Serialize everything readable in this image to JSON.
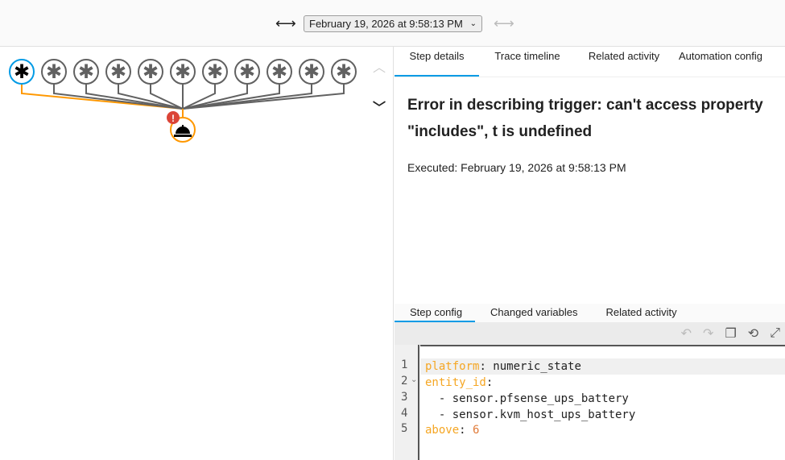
{
  "topbar": {
    "date": "February 19, 2026 at 9:58:13 PM",
    "prev_icon": "arrow-left-icon",
    "next_icon": "arrow-right-icon"
  },
  "graph": {
    "trigger_count": 11,
    "active_trigger": 0,
    "action_icon": "bell-icon",
    "error_badge": "!"
  },
  "tabs": [
    {
      "label": "Step details"
    },
    {
      "label": "Trace timeline"
    },
    {
      "label": "Related activity"
    },
    {
      "label": "Automation config"
    }
  ],
  "details": {
    "heading": "Error in describing trigger: can't access property \"includes\", t is undefined",
    "executed": "Executed: February 19, 2026 at 9:58:13 PM"
  },
  "bottom_tabs": [
    {
      "label": "Step config"
    },
    {
      "label": "Changed variables"
    },
    {
      "label": "Related activity"
    }
  ],
  "code": {
    "line_numbers": [
      "1",
      "2",
      "3",
      "4",
      "5"
    ],
    "l1k": "platform",
    "l1v": ": numeric_state",
    "l2k": "entity_id",
    "l2v": ":",
    "l3": "  - sensor.pfsense_ups_battery",
    "l4": "  - sensor.kvm_host_ups_battery",
    "l5k": "above",
    "l5s": ": ",
    "l5v": "6"
  },
  "colors": {
    "accent": "#039be5",
    "trace": "#ff9800",
    "error": "#db4437"
  }
}
